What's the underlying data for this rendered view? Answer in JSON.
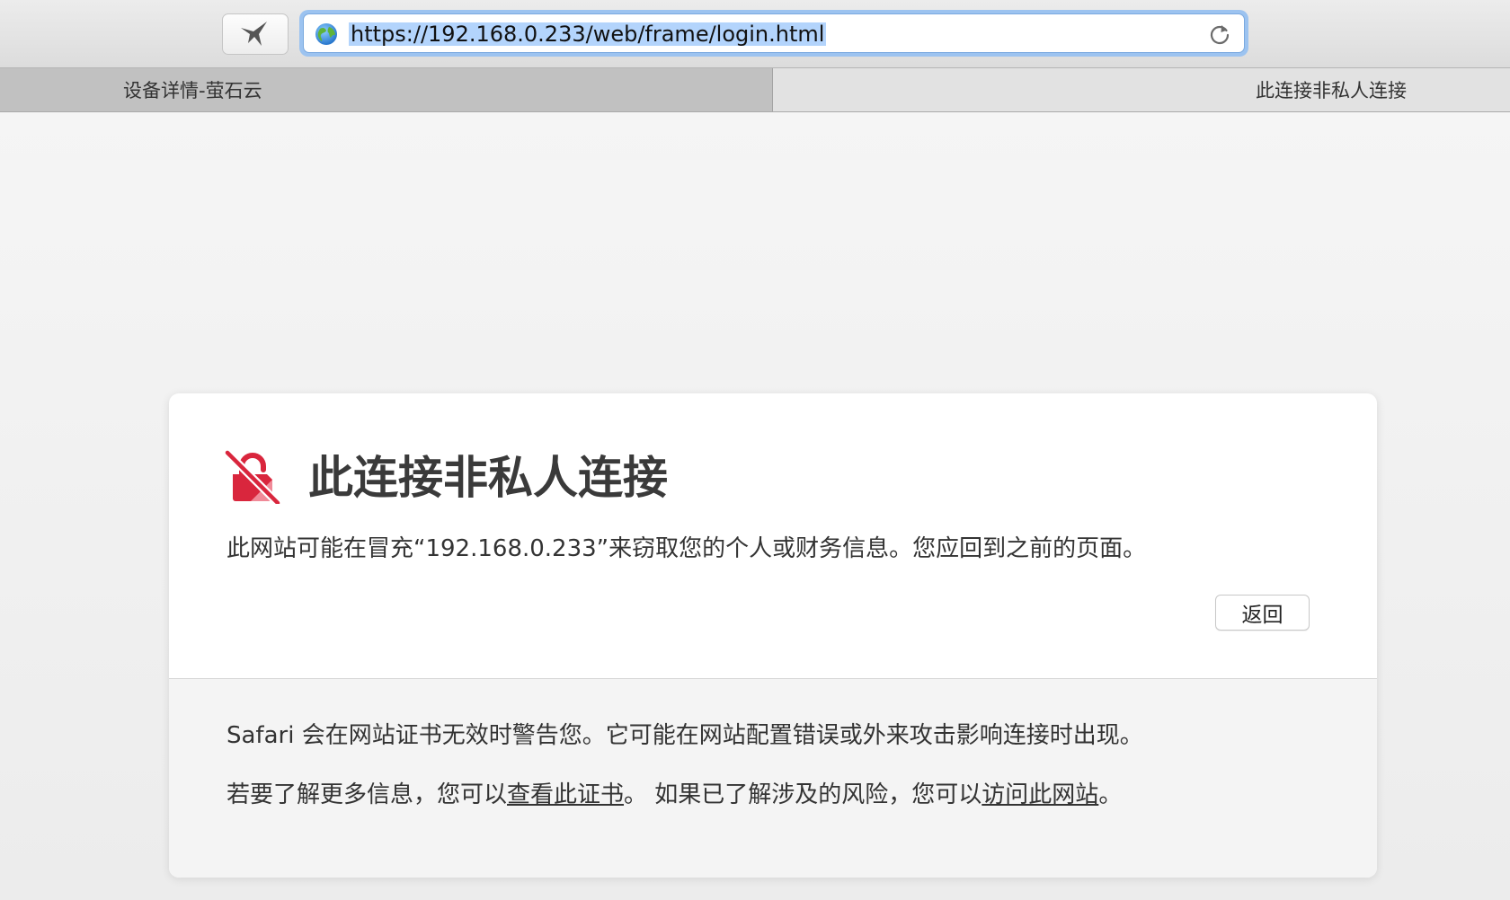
{
  "toolbar": {
    "url": "https://192.168.0.233/web/frame/login.html"
  },
  "tabs": [
    {
      "label": "设备详情-萤石云",
      "active": false
    },
    {
      "label": "此连接非私人连接",
      "active": true
    }
  ],
  "warning": {
    "title": "此连接非私人连接",
    "message": "此网站可能在冒充“192.168.0.233”来窃取您的个人或财务信息。您应回到之前的页面。",
    "back_label": "返回",
    "info_line1": "Safari 会在网站证书无效时警告您。它可能在网站配置错误或外来攻击影响连接时出现。",
    "info_line2_prefix": "若要了解更多信息，您可以",
    "view_cert_link": "查看此证书",
    "info_line2_middle": "。 如果已了解涉及的风险，您可以",
    "visit_site_link": "访问此网站",
    "info_line2_suffix": "。"
  },
  "colors": {
    "accent_blue": "#9cc3f0",
    "warning_red": "#d9263d",
    "selection": "#b3d4fc"
  },
  "icons": {
    "share": "share-bird-icon",
    "globe": "globe-icon",
    "reload": "reload-icon",
    "warning": "broken-lock-icon"
  }
}
